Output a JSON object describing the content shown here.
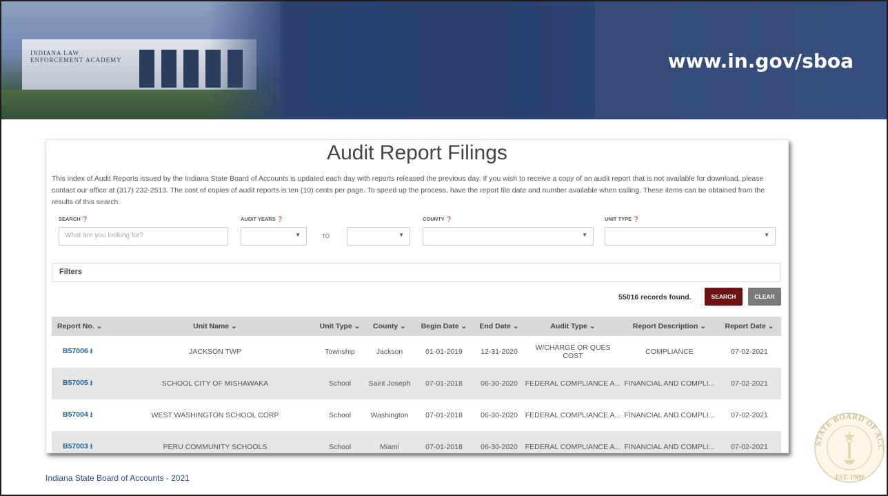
{
  "banner": {
    "url": "www.in.gov/sboa",
    "photo_sign": "INDIANA LAW ENFORCEMENT ACADEMY"
  },
  "page": {
    "title": "Audit Report Filings",
    "intro": "This index of Audit Reports issued by the Indiana State Board of Accounts is updated each day with reports released the previous day. If you wish to receive a copy of an audit report that is not available for download, please contact our office at (317) 232-2513. The cost of copies of audit reports is ten (10) cents per page. To speed up the process, have the report file date and number available when calling. These items can be obtained from the results of this search."
  },
  "form": {
    "search_label": "SEARCH",
    "search_placeholder": "What are you looking for?",
    "audit_years_label": "AUDIT YEARS",
    "to_label": "TO",
    "county_label": "COUNTY",
    "unit_type_label": "UNIT TYPE",
    "caret": "▼",
    "help": "❓"
  },
  "filters": {
    "label": "Filters"
  },
  "results": {
    "count_text": "55016 records found.",
    "search_btn": "SEARCH",
    "clear_btn": "CLEAR"
  },
  "table": {
    "headers": [
      "Report No. ⌄",
      "Unit Name ⌄",
      "Unit Type ⌄",
      "County ⌄",
      "Begin Date ⌄",
      "End Date ⌄",
      "Audit Type ⌄",
      "Report Description ⌄",
      "Report Date ⌄"
    ],
    "rows": [
      [
        "B57006",
        "JACKSON TWP",
        "Township",
        "Jackson",
        "01-01-2019",
        "12-31-2020",
        "W/CHARGE OR QUES COST",
        "COMPLIANCE",
        "07-02-2021"
      ],
      [
        "B57005",
        "SCHOOL CITY OF MISHAWAKA",
        "School",
        "Saint Joseph",
        "07-01-2018",
        "06-30-2020",
        "FEDERAL COMPLIANCE A...",
        "FINANCIAL AND COMPLI...",
        "07-02-2021"
      ],
      [
        "B57004",
        "WEST WASHINGTON SCHOOL CORP",
        "School",
        "Washington",
        "07-01-2018",
        "06-30-2020",
        "FEDERAL COMPLIANCE A...",
        "FINANCIAL AND COMPLI...",
        "07-02-2021"
      ],
      [
        "B57003",
        "PERU COMMUNITY SCHOOLS",
        "School",
        "Miami",
        "07-01-2018",
        "06-30-2020",
        "FEDERAL COMPLIANCE A...",
        "FINANCIAL AND COMPLI...",
        "07-02-2021"
      ]
    ]
  },
  "footer": {
    "text": "Indiana State Board of Accounts - 2021"
  },
  "seal": {
    "top_text": "STATE BOARD OF ACCOUNTS",
    "est": "EST. 1909"
  },
  "colors": {
    "banner": "#2c4373",
    "search_btn": "#6d1212",
    "clear_btn": "#7a7a7a",
    "link": "#1f5fa8"
  }
}
